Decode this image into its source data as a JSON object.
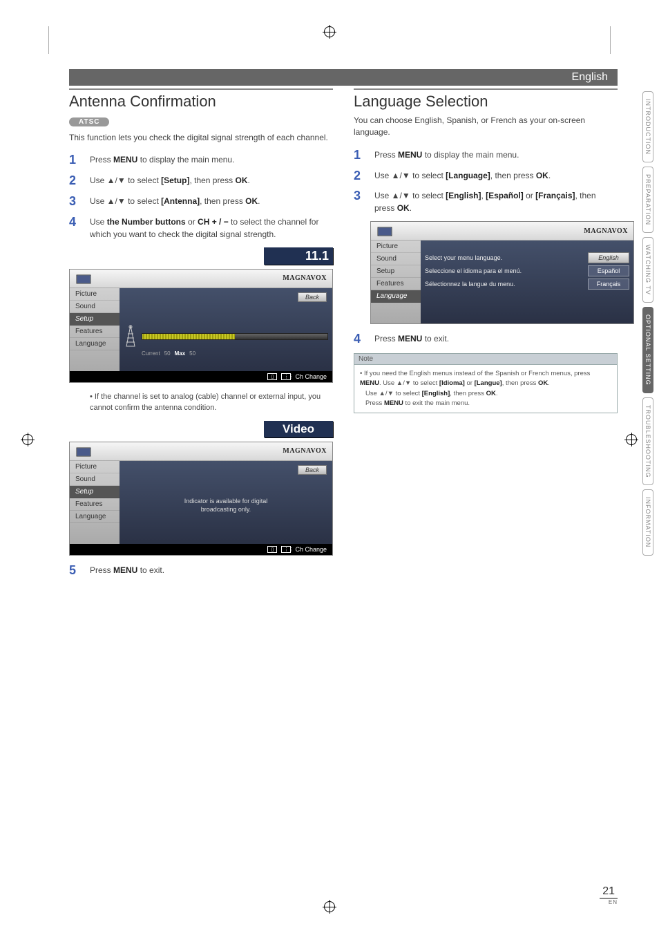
{
  "header": {
    "lang": "English"
  },
  "tabs": [
    "INTRODUCTION",
    "PREPARATION",
    "WATCHING TV",
    "OPTIONAL SETTING",
    "TROUBLESHOOTING",
    "INFORMATION"
  ],
  "active_tab_index": 3,
  "page_number": "21",
  "page_suffix": "EN",
  "left": {
    "title": "Antenna Confirmation",
    "badge": "ATSC",
    "intro": "This function lets you check the digital signal strength of each channel.",
    "steps": [
      {
        "n": "1",
        "pre": "Press ",
        "b1": "MENU",
        "post": " to display the main menu."
      },
      {
        "n": "2",
        "pre": "Use ▲/▼ to select ",
        "b1": "[Setup]",
        "mid": ", then press ",
        "b2": "OK",
        "post": "."
      },
      {
        "n": "3",
        "pre": "Use ▲/▼ to select ",
        "b1": "[Antenna]",
        "mid": ", then press ",
        "b2": "OK",
        "post": "."
      },
      {
        "n": "4",
        "pre": "Use ",
        "b1": "the Number buttons",
        "mid": " or ",
        "b2": "CH + / −",
        "post": " to select the channel for which you want to check the digital signal strength."
      }
    ],
    "channel_box": "11.1",
    "tv1": {
      "logo": "MAGNAVOX",
      "back": "Back",
      "sidebar": [
        "Picture",
        "Sound",
        "Setup",
        "Features",
        "Language"
      ],
      "sel_index": 2,
      "current_lbl": "Current",
      "current_val": "50",
      "max_lbl": "Max",
      "max_val": "50",
      "footer": "Ch Change"
    },
    "bullet": "If the channel is set to analog (cable) channel or external input, you cannot confirm the antenna condition.",
    "video_box": "Video",
    "tv2": {
      "logo": "MAGNAVOX",
      "back": "Back",
      "sidebar": [
        "Picture",
        "Sound",
        "Setup",
        "Features",
        "Language"
      ],
      "sel_index": 2,
      "msg1": "Indicator is available for digital",
      "msg2": "broadcasting only.",
      "footer": "Ch Change"
    },
    "step5": {
      "n": "5",
      "pre": "Press ",
      "b1": "MENU",
      "post": " to exit."
    }
  },
  "right": {
    "title": "Language Selection",
    "intro": "You can choose English, Spanish, or French as your on-screen language.",
    "steps": [
      {
        "n": "1",
        "pre": "Press ",
        "b1": "MENU",
        "post": " to display the main menu."
      },
      {
        "n": "2",
        "pre": "Use ▲/▼ to select ",
        "b1": "[Language]",
        "mid": ", then press ",
        "b2": "OK",
        "post": "."
      },
      {
        "n": "3",
        "pre": "Use ▲/▼ to select ",
        "b1": "[English]",
        "mid": ", ",
        "b2": "[Español]",
        "mid2": " or ",
        "b3": "[Français]",
        "post": ", then press ",
        "b4": "OK",
        "post2": "."
      }
    ],
    "tv": {
      "logo": "MAGNAVOX",
      "sidebar": [
        "Picture",
        "Sound",
        "Setup",
        "Features",
        "Language"
      ],
      "sel_index": 4,
      "rows": [
        {
          "txt": "Select your menu language.",
          "opt": "English",
          "sel": true
        },
        {
          "txt": "Seleccione el idioma para el menú.",
          "opt": "Español",
          "sel": false
        },
        {
          "txt": "Sélectionnez la langue du menu.",
          "opt": "Français",
          "sel": false
        }
      ]
    },
    "step4": {
      "n": "4",
      "pre": "Press ",
      "b1": "MENU",
      "post": " to exit."
    },
    "note": {
      "hdr": "Note",
      "line1_pre": "• If you need the English menus instead of the Spanish or French menus, press ",
      "line1_b1": "MENU",
      "line1_mid": ". Use ▲/▼ to select ",
      "line1_b2": "[Idioma]",
      "line1_mid2": " or ",
      "line1_b3": "[Langue]",
      "line1_mid3": ", then press ",
      "line1_b4": "OK",
      "line1_post": ".",
      "line2_pre": "Use ▲/▼ to select ",
      "line2_b1": "[English]",
      "line2_mid": ", then press ",
      "line2_b2": "OK",
      "line2_post": ".",
      "line3_pre": "Press ",
      "line3_b1": "MENU",
      "line3_post": " to exit the main menu."
    }
  }
}
